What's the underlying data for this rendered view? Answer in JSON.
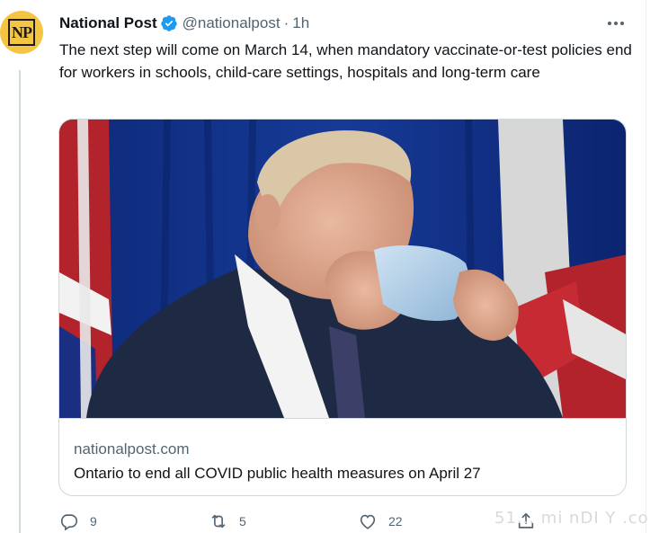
{
  "tweet": {
    "avatar_text": "NP",
    "display_name": "National Post",
    "handle": "@nationalpost",
    "separator": "·",
    "time": "1h",
    "text": "The next step will come on March 14, when mandatory vaccinate-or-test policies end for workers in schools, child-care settings, hospitals and long-term care"
  },
  "card": {
    "domain": "nationalpost.com",
    "title": "Ontario to end all COVID public health measures on April 27"
  },
  "actions": {
    "reply_count": "9",
    "retweet_count": "5",
    "like_count": "22"
  },
  "watermark": "51... mi nDI Y .co",
  "colors": {
    "verified": "#1d9bf0",
    "secondary_text": "#536471",
    "avatar_bg": "#f4c542"
  },
  "icons": {
    "verified": "verified-badge-icon",
    "more": "more-dots-icon",
    "reply": "reply-icon",
    "retweet": "retweet-icon",
    "like": "heart-icon",
    "share": "share-icon"
  }
}
